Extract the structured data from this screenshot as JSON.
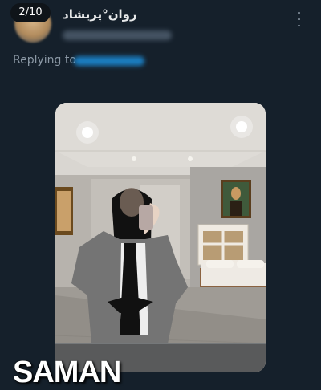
{
  "tweet": {
    "counter": "2/10",
    "display_name": "روان°پریشاد",
    "replying_label": "Replying to",
    "menu_icon": "more-vertical-icon",
    "watermark": "SAMAN"
  },
  "colors": {
    "background": "#15202b",
    "text_primary": "#e7e9ea",
    "text_secondary": "#8b98a5",
    "accent": "#1d9bf0"
  }
}
